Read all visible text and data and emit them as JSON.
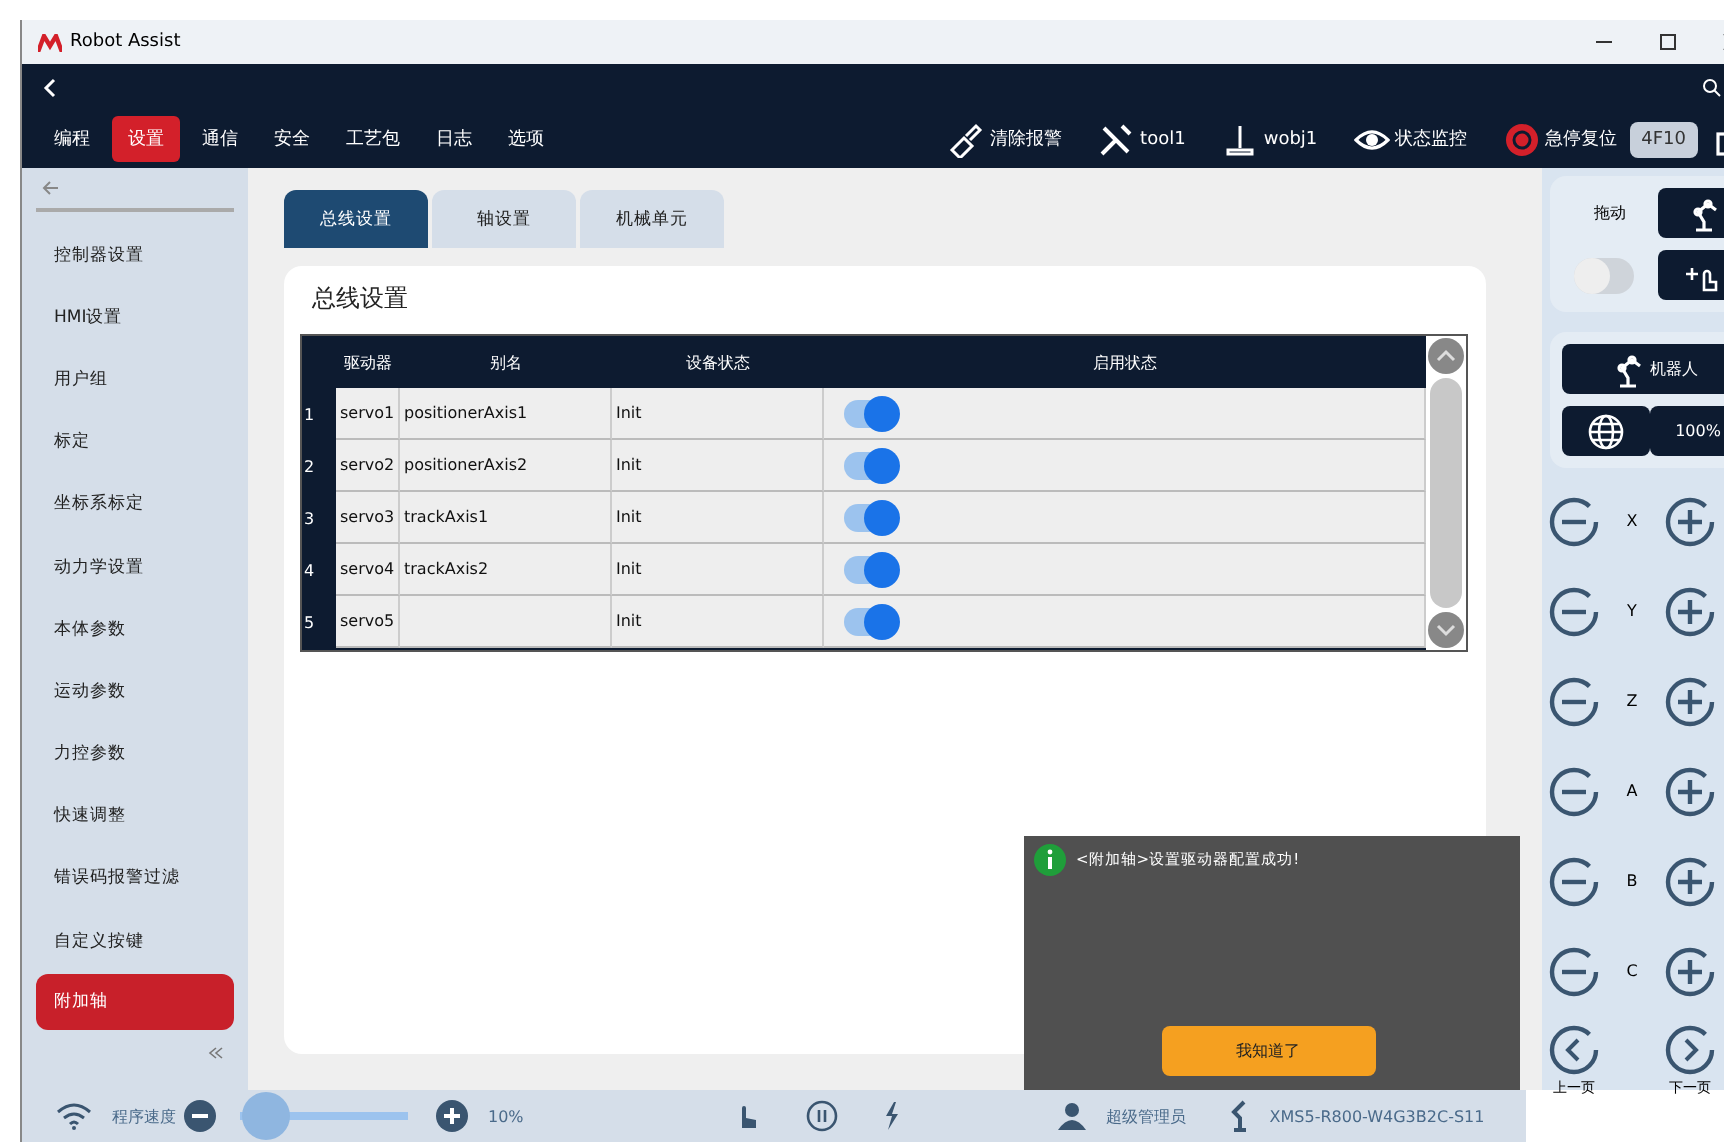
{
  "window": {
    "title": "Robot Assist"
  },
  "menu": [
    {
      "label": "编程",
      "selected": false
    },
    {
      "label": "设置",
      "selected": true
    },
    {
      "label": "通信",
      "selected": false
    },
    {
      "label": "安全",
      "selected": false
    },
    {
      "label": "工艺包",
      "selected": false
    },
    {
      "label": "日志",
      "selected": false
    },
    {
      "label": "选项",
      "selected": false
    }
  ],
  "toolbar": [
    {
      "kind": "clear",
      "label": "清除报警"
    },
    {
      "kind": "tool",
      "label": "tool1"
    },
    {
      "kind": "wobj",
      "label": "wobj1"
    },
    {
      "kind": "monitor",
      "label": "状态监控"
    },
    {
      "kind": "estop",
      "label": "急停复位"
    },
    {
      "kind": "badge",
      "label": "4F10"
    }
  ],
  "sidebar": {
    "items": [
      {
        "label": "控制器设置",
        "selected": false
      },
      {
        "label": "HMI设置",
        "selected": false
      },
      {
        "label": "用户组",
        "selected": false
      },
      {
        "label": "标定",
        "selected": false
      },
      {
        "label": "坐标系标定",
        "selected": false
      },
      {
        "label": "动力学设置",
        "selected": false
      },
      {
        "label": "本体参数",
        "selected": false
      },
      {
        "label": "运动参数",
        "selected": false
      },
      {
        "label": "力控参数",
        "selected": false
      },
      {
        "label": "快速调整",
        "selected": false
      },
      {
        "label": "错误码报警过滤",
        "selected": false
      },
      {
        "label": "自定义按键",
        "selected": false
      },
      {
        "label": "附加轴",
        "selected": true
      }
    ]
  },
  "tabs": [
    {
      "label": "总线设置",
      "selected": true
    },
    {
      "label": "轴设置",
      "selected": false
    },
    {
      "label": "机械单元",
      "selected": false
    }
  ],
  "panel": {
    "title": "总线设置"
  },
  "table": {
    "columns": [
      "驱动器",
      "别名",
      "设备状态",
      "启用状态"
    ],
    "rows": [
      {
        "index": "1",
        "driver": "servo1",
        "alias": "positionerAxis1",
        "status": "Init",
        "enabled": true
      },
      {
        "index": "2",
        "driver": "servo2",
        "alias": "positionerAxis2",
        "status": "Init",
        "enabled": true
      },
      {
        "index": "3",
        "driver": "servo3",
        "alias": "trackAxis1",
        "status": "Init",
        "enabled": true
      },
      {
        "index": "4",
        "driver": "servo4",
        "alias": "trackAxis2",
        "status": "Init",
        "enabled": true
      },
      {
        "index": "5",
        "driver": "servo5",
        "alias": "",
        "status": "Init",
        "enabled": true
      }
    ]
  },
  "right_panel": {
    "drag_label": "拖动",
    "drag_on": false,
    "robot_button": "机器人",
    "speed": "100%",
    "axes": [
      "X",
      "Y",
      "Z",
      "A",
      "B",
      "C"
    ],
    "prev": "上一页",
    "next": "下一页"
  },
  "status_bar": {
    "speed_label": "程序速度",
    "level": 0.15,
    "speed": "10%",
    "user": "超级管理员",
    "model": "XMS5-R800-W4G3B2C-S11"
  },
  "toast": {
    "message": "<附加轴>设置驱动器配置成功!",
    "button": "我知道了"
  }
}
